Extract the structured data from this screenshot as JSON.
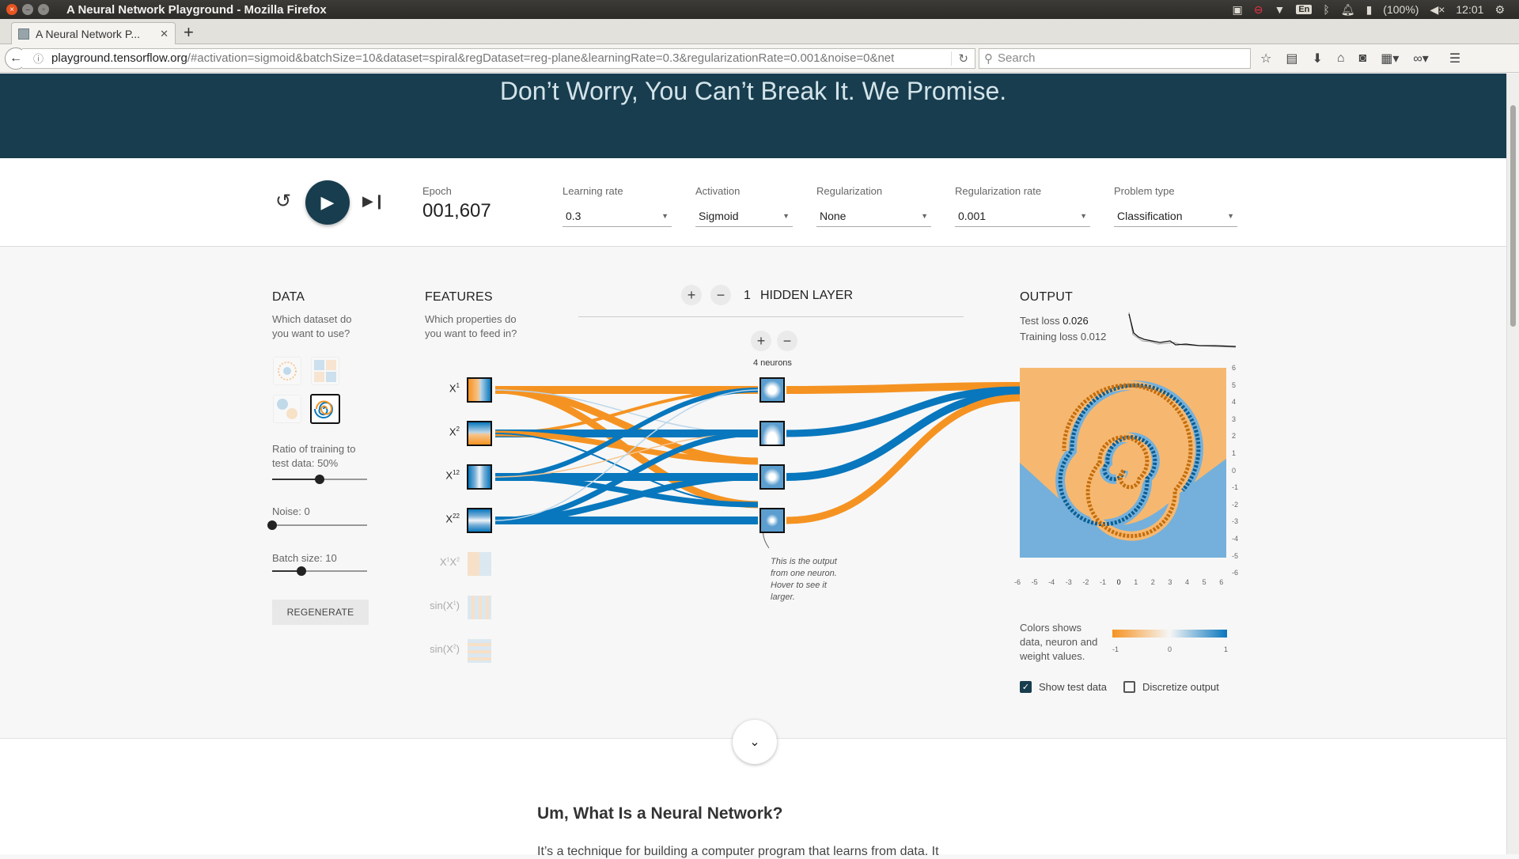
{
  "os": {
    "window_title": "A Neural Network Playground - Mozilla Firefox",
    "keyboard": "En",
    "battery": "(100%)",
    "clock": "12:01"
  },
  "browser": {
    "tab_title": "A Neural Network P...",
    "url_host": "playground.tensorflow.org",
    "url_rest": "/#activation=sigmoid&batchSize=10&dataset=spiral&regDataset=reg-plane&learningRate=0.3&regularizationRate=0.001&noise=0&net",
    "search_placeholder": "Search"
  },
  "hero": {
    "tagline": "Don’t Worry, You Can’t Break It. We Promise."
  },
  "controls": {
    "epoch_label": "Epoch",
    "epoch_value": "001,607",
    "learning_rate_label": "Learning rate",
    "learning_rate": "0.3",
    "activation_label": "Activation",
    "activation": "Sigmoid",
    "regularization_label": "Regularization",
    "regularization": "None",
    "reg_rate_label": "Regularization rate",
    "reg_rate": "0.001",
    "problem_label": "Problem type",
    "problem": "Classification"
  },
  "data_panel": {
    "title": "DATA",
    "subtitle": "Which dataset do you want to use?",
    "ratio_label": "Ratio of training to test data:",
    "ratio_value": "50%",
    "ratio_fraction": 0.5,
    "noise_label": "Noise:",
    "noise_value": "0",
    "noise_fraction": 0,
    "batch_label": "Batch size:",
    "batch_value": "10",
    "batch_fraction": 0.31,
    "regenerate": "REGENERATE"
  },
  "features": {
    "title": "FEATURES",
    "subtitle": "Which properties do you want to feed in?",
    "active": [
      "X1",
      "X2",
      "X1²",
      "X2²"
    ],
    "inactive": [
      "X1X2",
      "sin(X1)",
      "sin(X2)"
    ]
  },
  "network": {
    "layer_count": "1",
    "layer_label": "HIDDEN LAYER",
    "neurons_label": "4 neurons",
    "annotation": "This is the output from one neuron. Hover to see it larger."
  },
  "output": {
    "title": "OUTPUT",
    "test_loss_label": "Test loss",
    "test_loss": "0.026",
    "train_loss_label": "Training loss",
    "train_loss": "0.012",
    "y_ticks": [
      "6",
      "5",
      "4",
      "3",
      "2",
      "1",
      "0",
      "-1",
      "-2",
      "-3",
      "-4",
      "-5",
      "-6"
    ],
    "x_ticks": [
      "-6",
      "-5",
      "-4",
      "-3",
      "-2",
      "-1",
      "0",
      "1",
      "2",
      "3",
      "4",
      "5",
      "6"
    ],
    "legend_text": "Colors shows data, neuron and weight values.",
    "legend_ticks": [
      "-1",
      "0",
      "1"
    ],
    "show_test": "Show test data",
    "discretize": "Discretize output"
  },
  "article": {
    "heading": "Um, What Is a Neural Network?",
    "first_line": "It’s a technique for building a computer program that learns from data. It"
  },
  "colors": {
    "orange": "#f59322",
    "blue": "#0877bd",
    "hero": "#183d4e"
  }
}
